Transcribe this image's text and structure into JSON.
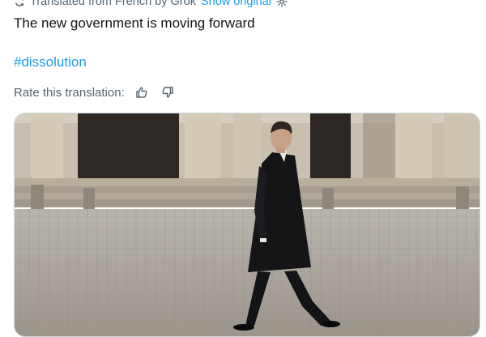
{
  "translation_bar": {
    "icon": "translate-icon",
    "text": "Translated from French by Grok",
    "show_original_label": "Show original",
    "settings_icon": "gear-icon"
  },
  "post": {
    "text": "The new government is moving forward",
    "hashtag": "#dissolution"
  },
  "rate": {
    "label": "Rate this translation:",
    "thumbs_up_icon": "thumbs-up-icon",
    "thumbs_down_icon": "thumbs-down-icon"
  },
  "media": {
    "icon": "photo",
    "colors": {
      "sky": "#d9d2c4",
      "building": "#bdb3a2",
      "doorway": "#2c2724",
      "ground": "#a9a39b",
      "coat": "#131316"
    }
  },
  "colors": {
    "link": "#1d9bf0",
    "text": "#0f1419",
    "secondary": "#536471"
  }
}
